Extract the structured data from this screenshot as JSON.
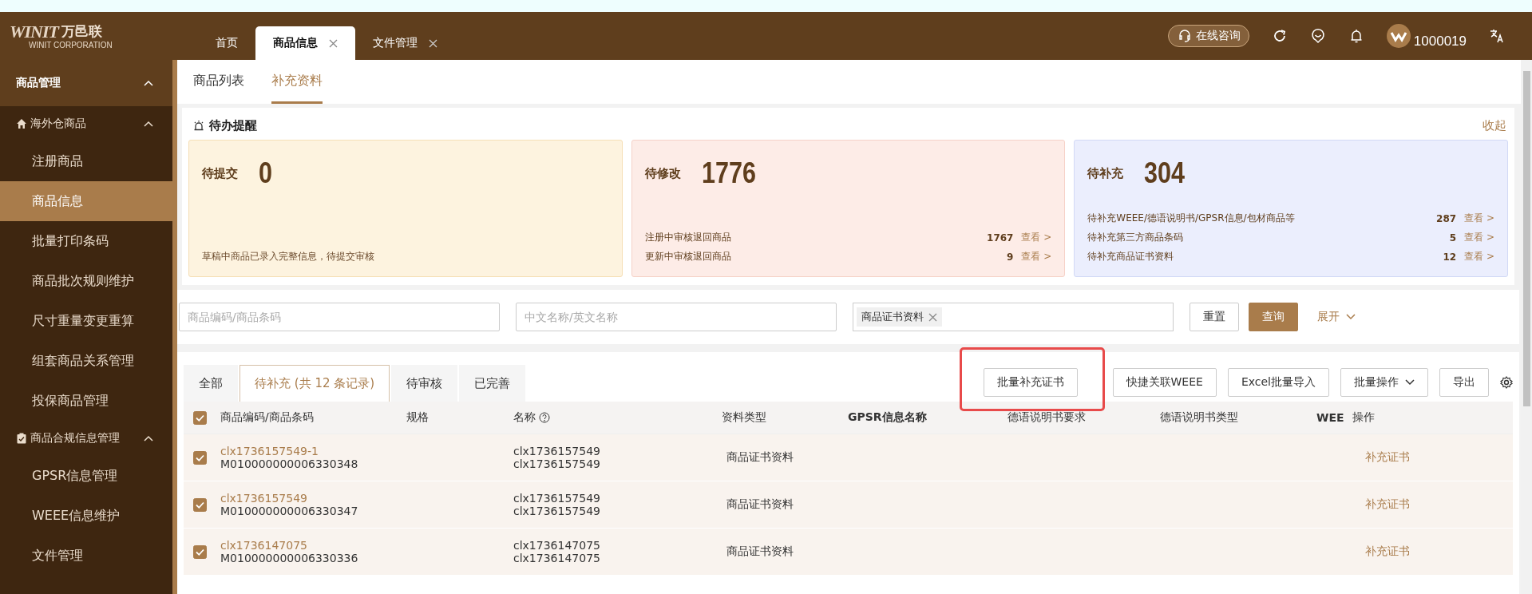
{
  "brand": {
    "mark": "WINIT",
    "name": "万邑联",
    "sub": "WINIT CORPORATION"
  },
  "top_tabs": [
    {
      "label": "首页",
      "selected": false,
      "closable": false
    },
    {
      "label": "商品信息",
      "selected": true,
      "closable": true
    },
    {
      "label": "文件管理",
      "selected": false,
      "closable": true
    }
  ],
  "header_actions": {
    "consult": "在线咨询",
    "user": "1000019"
  },
  "sidebar": {
    "title": "商品管理",
    "groups": [
      {
        "label": "海外仓商品",
        "kind": "home",
        "expanded": true,
        "children": [
          {
            "label": "注册商品",
            "selected": false
          },
          {
            "label": "商品信息",
            "selected": true
          },
          {
            "label": "批量打印条码",
            "selected": false
          },
          {
            "label": "商品批次规则维护",
            "selected": false
          },
          {
            "label": "尺寸重量变更重算",
            "selected": false
          },
          {
            "label": "组套商品关系管理",
            "selected": false
          },
          {
            "label": "投保商品管理",
            "selected": false
          }
        ]
      },
      {
        "label": "商品合规信息管理",
        "kind": "clipboard",
        "expanded": true,
        "children": [
          {
            "label": "GPSR信息管理",
            "selected": false
          },
          {
            "label": "WEEE信息维护",
            "selected": false
          },
          {
            "label": "文件管理",
            "selected": false
          }
        ]
      }
    ]
  },
  "sub_tabs": [
    {
      "label": "商品列表",
      "selected": false
    },
    {
      "label": "补充资料",
      "selected": true
    }
  ],
  "reminder": {
    "title": "待办提醒",
    "collapse": "收起",
    "cards": [
      {
        "kind": "note",
        "title": "待提交",
        "count": "0",
        "note": "草稿中商品已录入完整信息，待提交审核"
      },
      {
        "kind": "list",
        "title": "待修改",
        "count": "1776",
        "lines": [
          {
            "label": "注册中审核退回商品",
            "count": "1767",
            "link": "查看 >"
          },
          {
            "label": "更新中审核退回商品",
            "count": "9",
            "link": "查看 >"
          }
        ]
      },
      {
        "kind": "list",
        "title": "待补充",
        "count": "304",
        "lines": [
          {
            "label": "待补充WEEE/德语说明书/GPSR信息/包材商品等",
            "count": "287",
            "link": "查看 >"
          },
          {
            "label": "待补充第三方商品条码",
            "count": "5",
            "link": "查看 >"
          },
          {
            "label": "待补充商品证书资料",
            "count": "12",
            "link": "查看 >"
          }
        ]
      }
    ]
  },
  "filters": {
    "code_placeholder": "商品编码/商品条码",
    "name_placeholder": "中文名称/英文名称",
    "tag": "商品证书资料",
    "reset": "重置",
    "search": "查询",
    "expand": "展开"
  },
  "status_tabs": [
    {
      "label": "全部",
      "selected": false
    },
    {
      "label": "待补充 (共 12 条记录)",
      "selected": true
    },
    {
      "label": "待审核",
      "selected": false
    },
    {
      "label": "已完善",
      "selected": false
    }
  ],
  "toolbar": [
    {
      "label": "批量补充证书",
      "highlighted": true,
      "dropdown": false
    },
    {
      "label": "快捷关联WEEE",
      "highlighted": false,
      "dropdown": false
    },
    {
      "label": "Excel批量导入",
      "highlighted": false,
      "dropdown": false
    },
    {
      "label": "批量操作",
      "highlighted": false,
      "dropdown": true
    },
    {
      "label": "导出",
      "highlighted": false,
      "dropdown": false
    }
  ],
  "table": {
    "all_checked": true,
    "columns": [
      "商品编码/商品条码",
      "规格",
      "名称",
      "资料类型",
      "GPSR信息名称",
      "德语说明书要求",
      "德语说明书类型",
      "WEE",
      "操作"
    ],
    "rows": [
      {
        "selected": true,
        "code": "clx1736157549-1",
        "barcode": "M010000000006330348",
        "name": [
          "clx1736157549",
          "clx1736157549"
        ],
        "type": "商品证书资料",
        "action": "补充证书"
      },
      {
        "selected": true,
        "code": "clx1736157549",
        "barcode": "M010000000006330347",
        "name": [
          "clx1736157549",
          "clx1736157549"
        ],
        "type": "商品证书资料",
        "action": "补充证书"
      },
      {
        "selected": true,
        "code": "clx1736147075",
        "barcode": "M010000000006330336",
        "name": [
          "clx1736147075",
          "clx1736147075"
        ],
        "type": "商品证书资料",
        "action": "补充证书"
      }
    ]
  }
}
